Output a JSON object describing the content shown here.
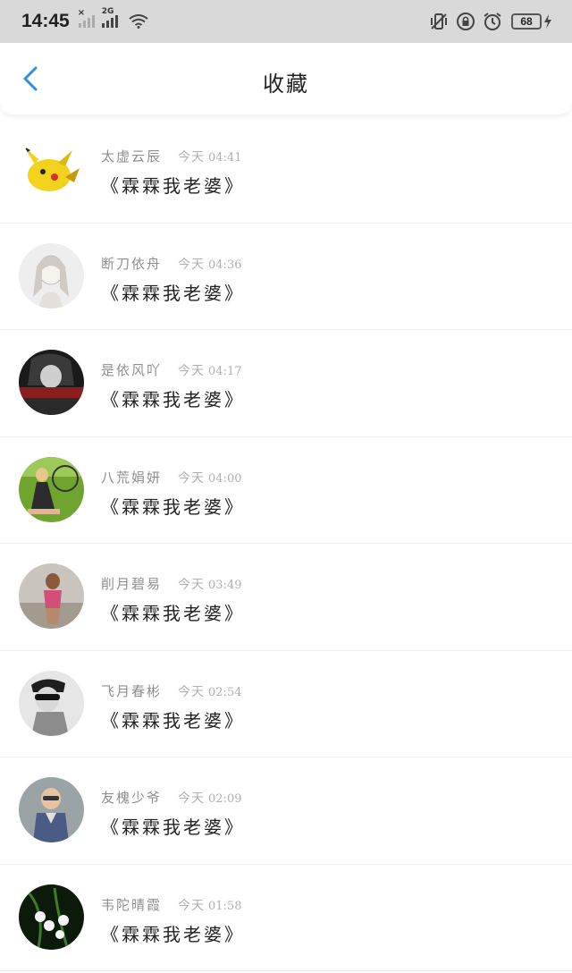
{
  "status_bar": {
    "time": "14:45",
    "network_label": "2G",
    "battery": "68"
  },
  "header": {
    "title": "收藏"
  },
  "favorites": [
    {
      "name": "太虚云辰",
      "date": "今天",
      "time": "04:41",
      "book": "《霖霖我老婆》",
      "avatar_icon": "pikachu-avatar"
    },
    {
      "name": "断刀依舟",
      "date": "今天",
      "time": "04:36",
      "book": "《霖霖我老婆》",
      "avatar_icon": "sketch-girl-avatar"
    },
    {
      "name": "是依风吖",
      "date": "今天",
      "time": "04:17",
      "book": "《霖霖我老婆》",
      "avatar_icon": "dark-art-avatar"
    },
    {
      "name": "八荒娟妍",
      "date": "今天",
      "time": "04:00",
      "book": "《霖霖我老婆》",
      "avatar_icon": "bicycle-girl-avatar"
    },
    {
      "name": "削月碧易",
      "date": "今天",
      "time": "03:49",
      "book": "《霖霖我老婆》",
      "avatar_icon": "beach-girl-avatar"
    },
    {
      "name": "飞月春彬",
      "date": "今天",
      "time": "02:54",
      "book": "《霖霖我老婆》",
      "avatar_icon": "sunglasses-avatar"
    },
    {
      "name": "友槐少爷",
      "date": "今天",
      "time": "02:09",
      "book": "《霖霖我老婆》",
      "avatar_icon": "child-avatar"
    },
    {
      "name": "韦陀晴霞",
      "date": "今天",
      "time": "01:58",
      "book": "《霖霖我老婆》",
      "avatar_icon": "flower-avatar"
    }
  ],
  "colors": {
    "accent": "#2c8fe0",
    "status_bar_bg": "#d9d9d9",
    "name_text": "#8e8e8e",
    "time_text": "#b0b0b0"
  }
}
